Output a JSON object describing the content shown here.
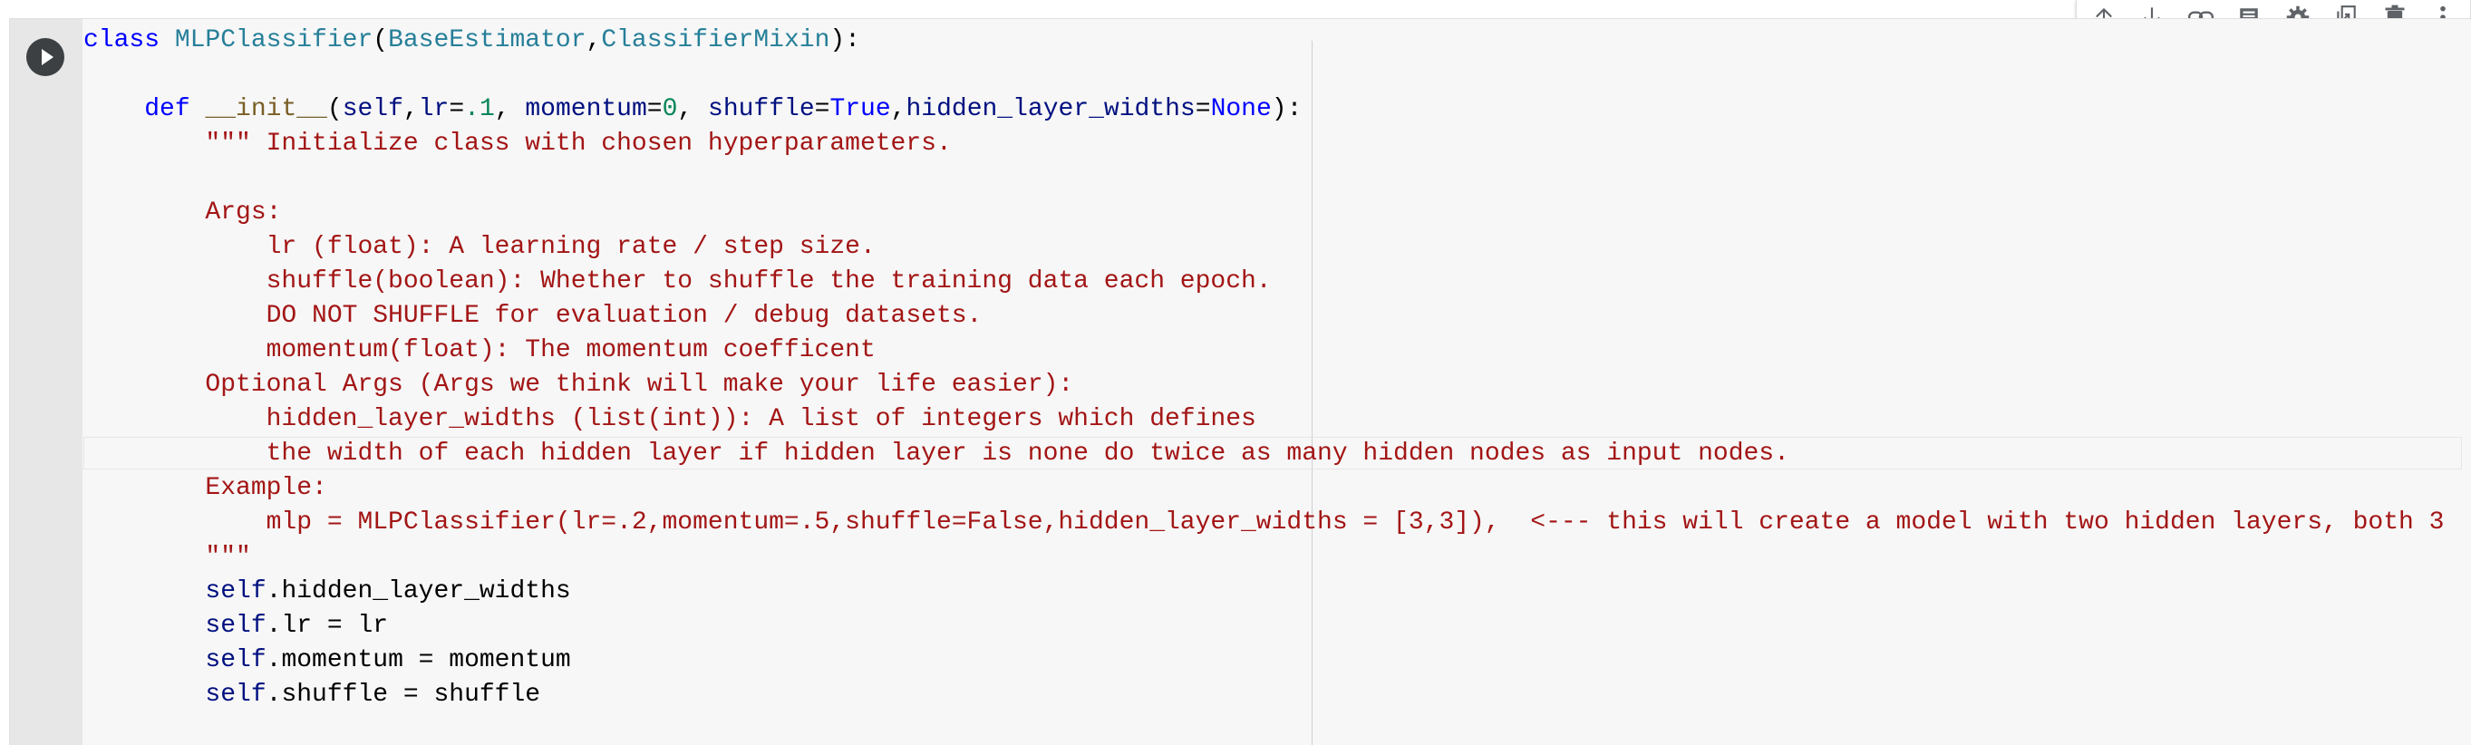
{
  "toolbar": {
    "icons": [
      "arrow-up-icon",
      "arrow-down-icon",
      "link-icon",
      "comment-icon",
      "gear-icon",
      "mirror-cell-icon",
      "trash-icon",
      "more-vert-icon"
    ]
  },
  "code": {
    "line1": {
      "kw": "class",
      "name": "MLPClassifier",
      "p1": "(",
      "base1": "BaseEstimator",
      "comma": ",",
      "base2": "ClassifierMixin",
      "p2": "):"
    },
    "line3": {
      "indent": "    ",
      "kw": "def",
      "sp": " ",
      "fn": "__init__",
      "p1": "(",
      "self": "self",
      "c1": ",",
      "lr": "lr",
      "eq1": "=",
      "lrv": ".1",
      "c2": ", ",
      "mom": "momentum",
      "eq2": "=",
      "momv": "0",
      "c3": ", ",
      "sh": "shuffle",
      "eq3": "=",
      "shv": "True",
      "c4": ",",
      "hl": "hidden_layer_widths",
      "eq4": "=",
      "hlv": "None",
      "p2": "):"
    },
    "doc": [
      "        \"\"\" Initialize class with chosen hyperparameters.",
      "",
      "        Args:",
      "            lr (float): A learning rate / step size.",
      "            shuffle(boolean): Whether to shuffle the training data each epoch.",
      "            DO NOT SHUFFLE for evaluation / debug datasets.",
      "            momentum(float): The momentum coefficent",
      "        Optional Args (Args we think will make your life easier):",
      "            hidden_layer_widths (list(int)): A list of integers which defines",
      "            the width of each hidden layer if hidden layer is none do twice as many hidden nodes as input nodes.",
      "        Example:",
      "            mlp = MLPClassifier(lr=.2,momentum=.5,shuffle=False,hidden_layer_widths = [3,3]),  <--- this will create a model with two hidden layers, both 3",
      "        \"\"\""
    ],
    "assign": [
      {
        "indent": "        ",
        "self": "self",
        "rest": ".hidden_layer_widths"
      },
      {
        "indent": "        ",
        "self": "self",
        "rest": ".lr = lr"
      },
      {
        "indent": "        ",
        "self": "self",
        "rest": ".momentum = momentum"
      },
      {
        "indent": "        ",
        "self": "self",
        "rest": ".shuffle = shuffle"
      }
    ]
  }
}
